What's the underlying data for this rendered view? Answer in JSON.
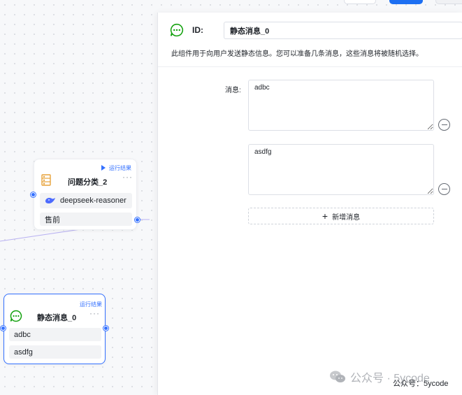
{
  "colors": {
    "accent": "#3370ff",
    "chat_icon_green": "#13a10e",
    "class_icon_amber": "#e7a23a",
    "edge": "#b9b2f2"
  },
  "canvas": {
    "classifier_node": {
      "run_label": "运行结果",
      "more": "···",
      "title": "问题分类_2",
      "model": "deepseek-reasoner",
      "category": "售前",
      "icon": "classifier-icon",
      "model_icon": "deepseek-whale-icon"
    },
    "message_node": {
      "run_label": "运行结果",
      "more": "···",
      "title": "静态消息_0",
      "icon": "chat-bubble-icon",
      "messages": [
        "adbc",
        "asdfg"
      ]
    }
  },
  "panel": {
    "icon": "chat-bubble-icon",
    "id_label": "ID:",
    "id_value": "静态消息_0",
    "description": "此组件用于向用户发送静态信息。您可以准备几条消息，这些消息将被随机选择。",
    "message_label": "消息:",
    "messages": [
      "adbc",
      "asdfg"
    ],
    "add_label": "新增消息"
  },
  "watermark": {
    "logo_text": "公众号 · 5ycode",
    "caption": "公众号：5ycode"
  }
}
